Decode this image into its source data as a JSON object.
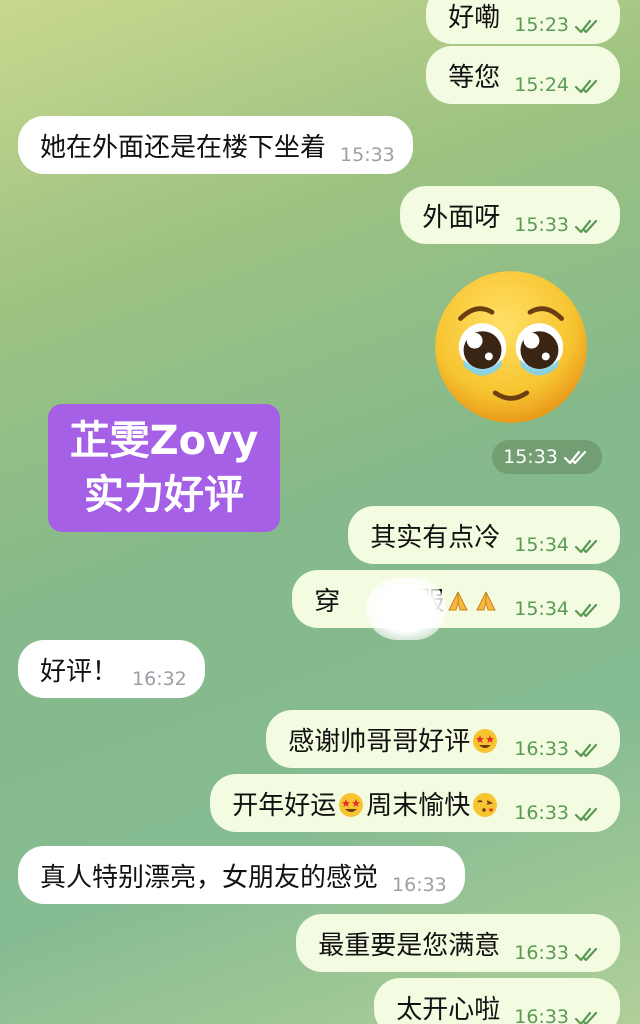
{
  "watermark": {
    "line1": "芷雯Zovy",
    "line2": "实力好评"
  },
  "emoji_sticker": {
    "icon": "pleading-face-icon",
    "time": "15:33",
    "read": true
  },
  "messages": [
    {
      "dir": "out",
      "text": "好嘞",
      "time": "15:23",
      "read": true
    },
    {
      "dir": "out",
      "text": "等您",
      "time": "15:24",
      "read": true
    },
    {
      "dir": "in",
      "text": "她在外面还是在楼下坐着",
      "time": "15:33"
    },
    {
      "dir": "out",
      "text": "外面呀",
      "time": "15:33",
      "read": true
    },
    {
      "dir": "out",
      "text": "其实有点冷",
      "time": "15:34",
      "read": true
    },
    {
      "dir": "out",
      "text_before": "穿",
      "text_after": "衣服",
      "time": "15:34",
      "read": true
    },
    {
      "dir": "in",
      "text": "好评！",
      "time": "16:32"
    },
    {
      "dir": "out",
      "text": "感谢帅哥哥好评",
      "time": "16:33",
      "read": true
    },
    {
      "dir": "out",
      "text_before": "开年好运",
      "text_after": "周末愉快",
      "time": "16:33",
      "read": true
    },
    {
      "dir": "in",
      "text": "真人特别漂亮，女朋友的感觉",
      "time": "16:33"
    },
    {
      "dir": "out",
      "text": "最重要是您满意",
      "time": "16:33",
      "read": true
    },
    {
      "dir": "out",
      "text": "太开心啦",
      "time": "16:33",
      "read": true
    }
  ],
  "colors": {
    "outgoing_bubble": "#f3fbe0",
    "incoming_bubble": "#ffffff",
    "read_check": "#5a9a55",
    "watermark_bg": "#a560e6"
  }
}
